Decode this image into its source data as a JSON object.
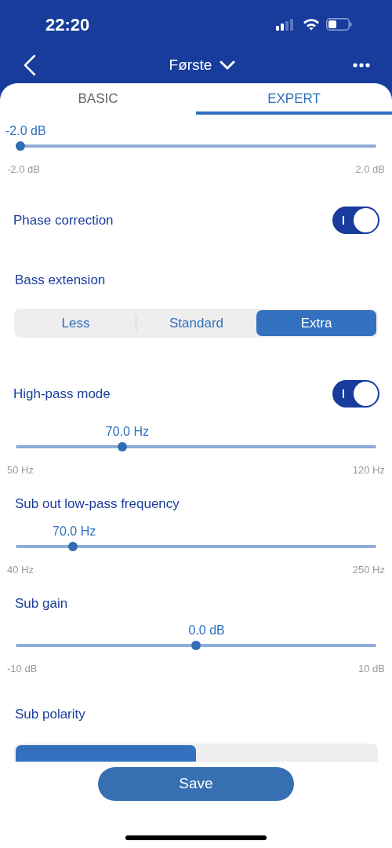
{
  "status_bar": {
    "time": "22:20"
  },
  "nav": {
    "title": "Første"
  },
  "tabs": [
    {
      "label": "BASIC",
      "selected": false
    },
    {
      "label": "EXPERT",
      "selected": true
    }
  ],
  "settings": [
    {
      "kind": "slider",
      "value": "-2.0 dB",
      "level": 0,
      "min": "-2.0 dB",
      "max": "2.0 dB"
    },
    {
      "kind": "toggle",
      "label": "Phase correction",
      "on": true
    },
    {
      "kind": "segmented",
      "label": "Bass extension",
      "segments": [
        {
          "label": "Less",
          "selected": false
        },
        {
          "label": "Standard",
          "selected": false
        },
        {
          "label": "Extra",
          "selected": true
        }
      ]
    },
    {
      "kind": "toggle",
      "label": "High-pass mode",
      "on": true
    },
    {
      "kind": "slider",
      "value": "70.0 Hz",
      "level": 0.29,
      "min": "50 Hz",
      "max": "120 Hz"
    },
    {
      "kind": "slider",
      "label": "Sub out low-pass frequency",
      "value": "70.0 Hz",
      "level": 0.15,
      "min": "40 Hz",
      "max": "250 Hz"
    },
    {
      "kind": "slider",
      "label": "Sub gain",
      "value": "0.0 dB",
      "level": 0.5,
      "min": "-10 dB",
      "max": "10 dB"
    },
    {
      "kind": "segmented",
      "label": "Sub polarity",
      "segments": [
        {
          "selected": true
        },
        {
          "selected": false
        }
      ]
    }
  ],
  "save_button": "Save"
}
